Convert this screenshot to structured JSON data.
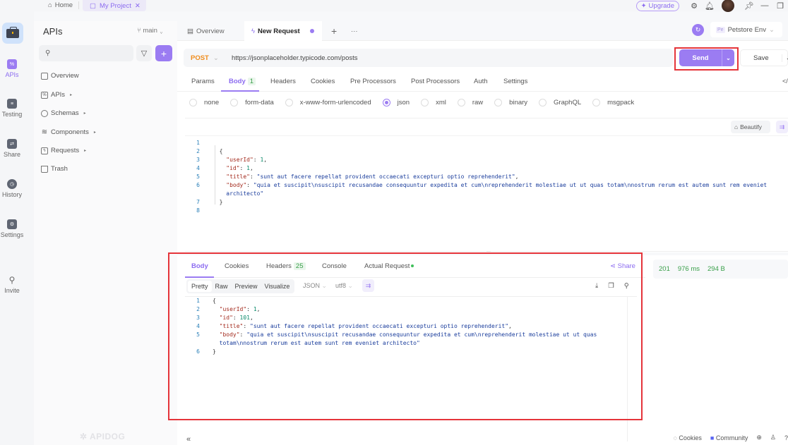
{
  "topbar": {
    "home_label": "Home",
    "project_tab_label": "My Project",
    "upgrade_label": "Upgrade"
  },
  "rail": {
    "items": [
      {
        "label": "APIs",
        "icon": "api-icon",
        "active": true
      },
      {
        "label": "Testing",
        "icon": "testing-icon"
      },
      {
        "label": "Share",
        "icon": "share-doc-icon"
      },
      {
        "label": "History",
        "icon": "history-icon"
      },
      {
        "label": "Settings",
        "icon": "settings-icon"
      },
      {
        "label": "Invite",
        "icon": "invite-user-icon"
      }
    ]
  },
  "sidebar": {
    "title": "APIs",
    "branch": "main",
    "search_placeholder": "",
    "items": [
      {
        "label": "Overview",
        "icon": "overview-icon",
        "expandable": false
      },
      {
        "label": "APIs",
        "icon": "api-icon",
        "expandable": true
      },
      {
        "label": "Schemas",
        "icon": "schema-icon",
        "expandable": true
      },
      {
        "label": "Components",
        "icon": "components-icon",
        "expandable": true
      },
      {
        "label": "Requests",
        "icon": "requests-icon",
        "expandable": true
      },
      {
        "label": "Trash",
        "icon": "trash-icon",
        "expandable": false
      }
    ],
    "watermark": "APIDOG"
  },
  "tabs": {
    "items": [
      {
        "label": "Overview"
      },
      {
        "label": "New Request",
        "active": true,
        "unsaved": true
      }
    ],
    "environment": "Petstore Env",
    "env_badge": "Pe"
  },
  "request": {
    "method": "POST",
    "url": "https://jsonplaceholder.typicode.com/posts",
    "send_label": "Send",
    "save_label": "Save",
    "tabs": [
      {
        "label": "Params"
      },
      {
        "label": "Body",
        "badge": "1",
        "active": true
      },
      {
        "label": "Headers"
      },
      {
        "label": "Cookies"
      },
      {
        "label": "Pre Processors"
      },
      {
        "label": "Post Processors"
      },
      {
        "label": "Auth"
      },
      {
        "label": "Settings"
      }
    ],
    "body_types": [
      "none",
      "form-data",
      "x-www-form-urlencoded",
      "json",
      "xml",
      "raw",
      "binary",
      "GraphQL",
      "msgpack"
    ],
    "selected_body_type": "json",
    "beautify_label": "Beautify",
    "body_lines": [
      {
        "n": "1",
        "text": ""
      },
      {
        "n": "2",
        "text": "{"
      },
      {
        "n": "3",
        "key": "\"userId\"",
        "val": "1",
        "type": "num"
      },
      {
        "n": "4",
        "key": "\"id\"",
        "val": "1",
        "type": "num"
      },
      {
        "n": "5",
        "key": "\"title\"",
        "val": "\"sunt aut facere repellat provident occaecati excepturi optio reprehenderit\"",
        "type": "str"
      },
      {
        "n": "6",
        "key": "\"body\"",
        "val": "\"quia et suscipit\\nsuscipit recusandae consequuntur expedita et cum\\nreprehenderit molestiae ut ut quas totam\\nnostrum rerum est autem sunt rem eveniet",
        "type": "str",
        "last": true
      },
      {
        "n": "",
        "cont": "architecto\""
      },
      {
        "n": "7",
        "text": "}"
      },
      {
        "n": "8",
        "text": ""
      }
    ]
  },
  "response": {
    "tabs": [
      {
        "label": "Body",
        "active": true
      },
      {
        "label": "Cookies"
      },
      {
        "label": "Headers",
        "badge": "25"
      },
      {
        "label": "Console"
      },
      {
        "label": "Actual Request",
        "dot": true
      }
    ],
    "share_label": "Share",
    "status_code": "201",
    "time": "976 ms",
    "size": "294 B",
    "view_modes": [
      "Pretty",
      "Raw",
      "Preview",
      "Visualize"
    ],
    "active_view": "Pretty",
    "format": "JSON",
    "encoding": "utf8",
    "body_lines": [
      {
        "n": "1",
        "text": "{"
      },
      {
        "n": "2",
        "key": "\"userId\"",
        "val": "1",
        "type": "num"
      },
      {
        "n": "3",
        "key": "\"id\"",
        "val": "101",
        "type": "num"
      },
      {
        "n": "4",
        "key": "\"title\"",
        "val": "\"sunt aut facere repellat provident occaecati excepturi optio reprehenderit\"",
        "type": "str"
      },
      {
        "n": "5",
        "key": "\"body\"",
        "val": "\"quia et suscipit\\nsuscipit recusandae consequuntur expedita et cum\\nreprehenderit molestiae ut ut quas",
        "type": "str",
        "last": true
      },
      {
        "n": "",
        "cont": "totam\\nnostrum rerum est autem sunt rem eveniet architecto\""
      },
      {
        "n": "6",
        "text": "}"
      }
    ]
  },
  "footer": {
    "collapse_icon": "«",
    "cookies_label": "Cookies",
    "community_label": "Community"
  }
}
